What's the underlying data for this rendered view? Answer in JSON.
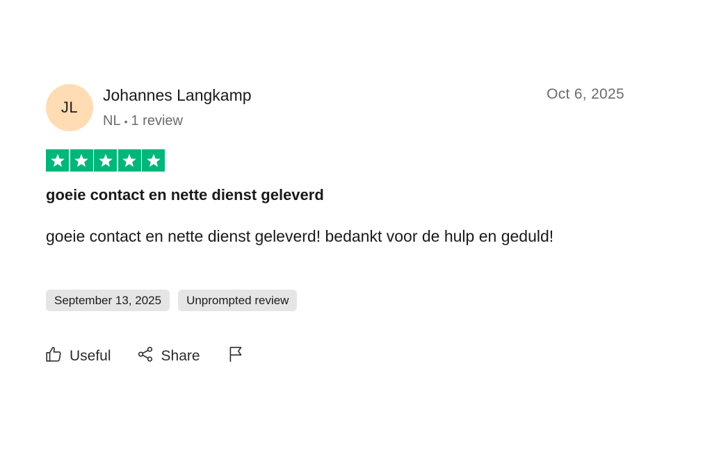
{
  "review": {
    "author": {
      "initials": "JL",
      "name": "Johannes Langkamp",
      "country": "NL",
      "review_count": "1 review"
    },
    "date": "Oct 6, 2025",
    "rating": 5,
    "rating_max": 5,
    "star_color": "#00b67a",
    "title": "goeie contact en nette dienst geleverd",
    "body": "goeie contact en nette dienst geleverd! bedankt voor de hulp en geduld!",
    "tags": [
      "September 13, 2025",
      "Unprompted review"
    ]
  },
  "actions": {
    "useful_label": "Useful",
    "share_label": "Share",
    "useful_icon": "thumbs-up-icon",
    "share_icon": "share-icon",
    "report_icon": "flag-icon"
  }
}
